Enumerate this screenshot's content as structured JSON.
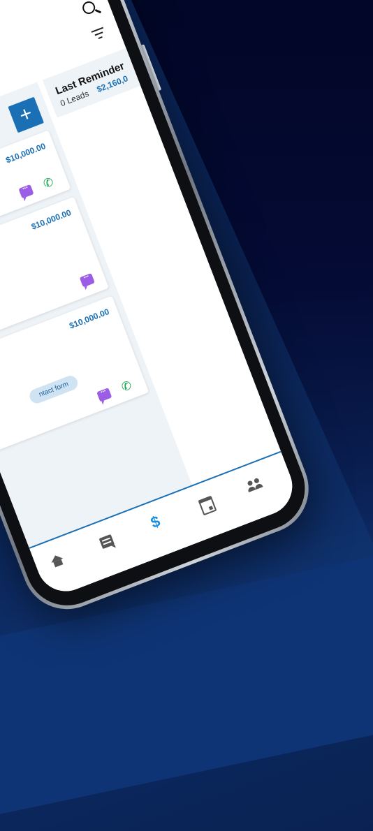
{
  "toolbar": {
    "search_icon": "search-icon",
    "filter_icon": "filter-icon"
  },
  "pipeline": {
    "add_label": "+",
    "columns": [
      {
        "cards": [
          {
            "value": "$10,000.00",
            "icons": [
              "message-icon",
              "phone-icon"
            ]
          },
          {
            "value": "$10,000.00",
            "icons": [
              "message-icon"
            ]
          },
          {
            "value": "$10,000.00",
            "tag": "ntact form",
            "icons": [
              "message-icon",
              "phone-icon"
            ]
          }
        ]
      },
      {
        "title": "Last Reminder",
        "leads": "0 Leads",
        "amount": "$2,160,0"
      }
    ]
  },
  "bottom_nav": {
    "items": [
      "home-icon",
      "chat-icon",
      "dollar-icon",
      "calendar-icon",
      "people-icon"
    ],
    "active": "dollar-icon"
  },
  "colors": {
    "accent": "#1a6fb5",
    "message": "#9b5de5",
    "phone": "#16a34a",
    "background": "#0a2150"
  }
}
